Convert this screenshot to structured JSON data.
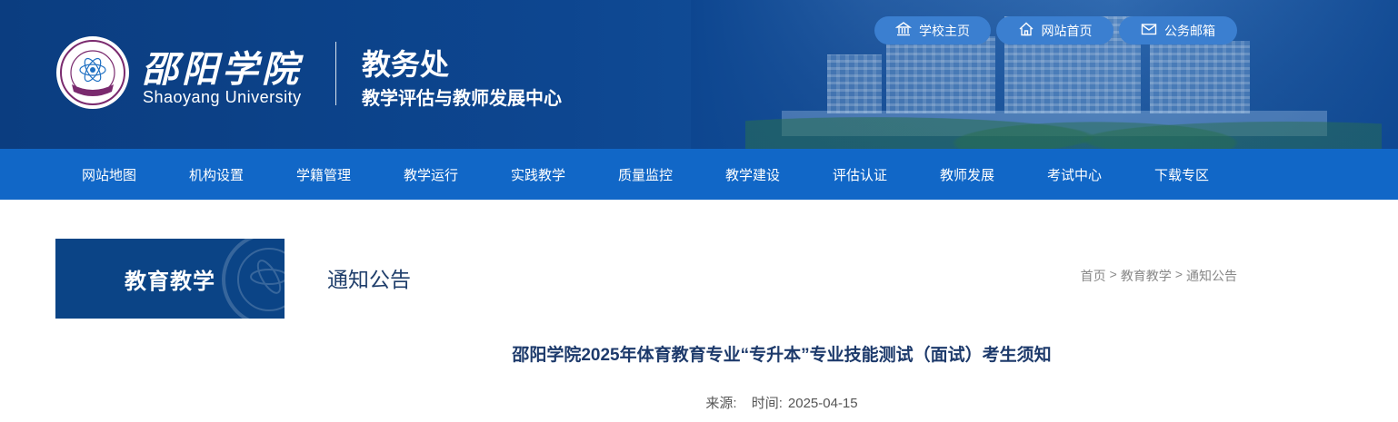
{
  "header": {
    "logo_cn": "邵阳学院",
    "logo_en": "Shaoyang University",
    "dept_title": "教务处",
    "dept_subtitle": "教学评估与教师发展中心",
    "top_links": [
      {
        "label": "学校主页",
        "icon": "school-building-icon"
      },
      {
        "label": "网站首页",
        "icon": "home-icon"
      },
      {
        "label": "公务邮箱",
        "icon": "mail-icon"
      }
    ],
    "colors": {
      "banner": "#0d4690",
      "nav": "#1167c7",
      "pill": "#3b7fd0"
    }
  },
  "nav": {
    "items": [
      "网站地图",
      "机构设置",
      "学籍管理",
      "教学运行",
      "实践教学",
      "质量监控",
      "教学建设",
      "评估认证",
      "教师发展",
      "考试中心",
      "下载专区"
    ]
  },
  "sidebar": {
    "title": "教育教学"
  },
  "section": {
    "title": "通知公告"
  },
  "breadcrumb": {
    "items": [
      "首页",
      "教育教学",
      "通知公告"
    ],
    "separator": ">"
  },
  "article": {
    "title": "邵阳学院2025年体育教育专业“专升本”专业技能测试（面试）考生须知",
    "source_label": "来源:",
    "source_value": "",
    "time_label": "时间:",
    "time_value": "2025-04-15"
  }
}
